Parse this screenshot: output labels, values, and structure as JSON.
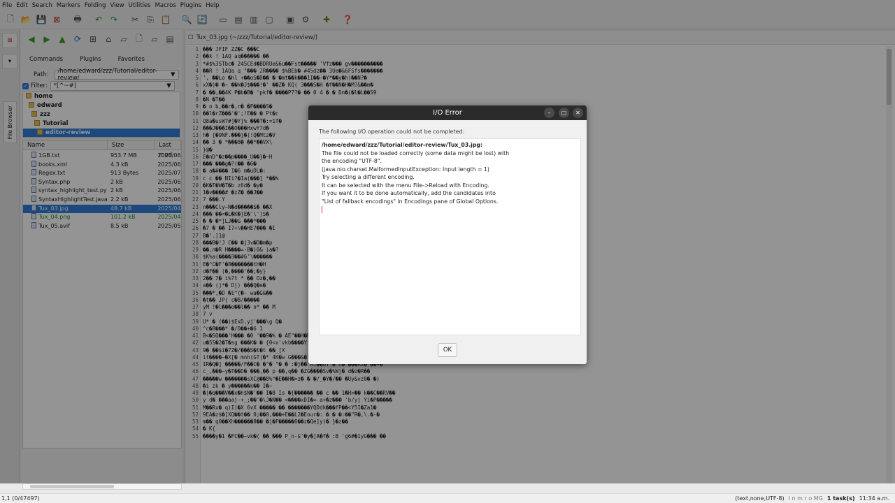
{
  "menu": [
    "File",
    "Edit",
    "Search",
    "Markers",
    "Folding",
    "View",
    "Utilities",
    "Macros",
    "Plugins",
    "Help"
  ],
  "fb": {
    "tabs": [
      "Commands",
      "Plugins",
      "Favorites"
    ],
    "path_label": "Path:",
    "path_value": "/home/edward/zzz/Tutorial/editor-review/",
    "filter_label": "Filter:",
    "filter_value": "*[^~#]",
    "tree": [
      "home",
      "edward",
      "zzz",
      "Tutorial",
      "editor-review"
    ],
    "cols": [
      "Name",
      "Size",
      "Last mod"
    ],
    "files": [
      [
        "1GB.txt",
        "953.7 MB",
        "2025/06/"
      ],
      [
        "books.xml",
        "4.3 kB",
        "2025/06/"
      ],
      [
        "Regex.txt",
        "913 Bytes",
        "2025/07/"
      ],
      [
        "Syntax.php",
        "2 kB",
        "2025/06/"
      ],
      [
        "syntax_highlight_test.py",
        "2 kB",
        "2025/06/"
      ],
      [
        "SyntaxHighlightTest.java",
        "2.2 kB",
        "2025/06/"
      ],
      [
        "Tux_03.jpg",
        "48.7 kB",
        "2025/04/"
      ],
      [
        "Tux_04.png",
        "101.2 kB",
        "2025/04/"
      ],
      [
        "Tux_05.avif",
        "8.5 kB",
        "2025/05/"
      ]
    ],
    "vtab": "File Browser"
  },
  "editor": {
    "title": "Tux_03.jpg (~/zzz/Tutorial/editor-review/)",
    "lines": [
      "\u0000\u0000\u0000 JFIF ZZ\u0000C \u0000\u0000\u0000C",
      "\u0000\u0000k ! 1AQ aq\u0000\u0000\u0000\u0000\u0000\u0000 \u0000\u0000",
      "*#$%3STbc\u0000 245CEd\u0000BDRUe&6u\u0000\u0000Fst\u0000\u0000\u0000\u0000\u0000 'Vfz\u0000\u0000\u0000 gv\u0000\u0000\u0000\u0000\u0000\u0000\u0000\u0000\u0000\u0000",
      "\u0000\u0000R ! 1AQa q \"\u0000\u0000\u0000 2R\u0000\u0000\u0000\u0000 $%BEb\u0000 #45dz\u0000\u0000 3Ue\u0000&6FSfs\u0000\u0000\u0000\u0000\u0000\u0000\u0000",
      "', \u0000\u0000Lo \u0000hl +\u0000\u0000oS\u0000D\u0000\u0000 \u0000 \u0000mt\u0000\u0000k\u0000\u0000\u00001I\u0000\u0000-\u0000Y*\u0000\u0000y\u0000h)\u0000\u0000N?\u0000",
      "xX\u0000)\u0000 \u0000~ \u0000\u0000k\u0000J$\u0000\u0000\u0000!\u0000' \u0000\u0000Z\u0000 KQ( 3\u0000\u0000\u0000S\u0000H \u0000f\u0000\u0000N\u0000H\u0000M?&\u0000\u0000m\u0000",
      "\u0000 \u0000\u0000,\u0000\u00004K P\u0000b\u0000B\u0000 'pkf\u0000 \u0000\u0000\u0000\u0000P7?\u0000 \u0000\u0000 0 4 \u0000 \u0000 Dn\u0000(\u0000l\u0000L\u0000\u0000S9",
      "\u0000N \u0000T\u0000\u0000",
      "\u0000 o b,\u0000\u0000r\u0000,r\u0000 \u0000F\u0000\u0000\u0000\u0000S\u0000",
      "\u0000\u0000l\u0000rZ\u0000\u0000\u0000'\u0000';!E\u0000\u0000 \u0000 Pt\u0000c",
      "Q8a\u0000usW7#]\u0000Yj% \u0000\u0000\u0000T\u0000:=1f\u0000",
      "\u0000\u0000\u0000J\u0000\u0000\u0000I\u0000\u0000O\u0000\u0000\u0000HxwY7d\u0000",
      "h\u0000 [\u00009NF.\u0000\u0000\u0000j\u0000(!Q\u0000Mtz\u0000V",
      "\u0000\u0000 3 \u0000 *\u0000\u0000\u00008\u0000 \u0000\u0000*\u0000\u0000VX\\",
      "}@\u0000",
      "E\u0000nD^\u0000z\u0000\u0000p\u0000\u0000\u0000\u0000_U\u0000\u0000}\u0000~H",
      "\u0000\u0000\u0000 \u0000\u0000\u0000g\u0000?(\u0000\u0000 \u00006\u0000",
      "\u0000 a\u0000#\u0000\u0000\u0000 I\u00006 m\u0000uDL\u0000:",
      "c c \u0000\u0000 NIi?\u0000Ia(\u0000\u0000\u0000] *\u0000\u0000%",
      "\u0000K\u0000T\u0000W\u0000T\u0000b z6d\u0000 \u0000y\u0000",
      "1\u0000v\u0000\u0000\u0000\u0000# \u0000zZ\u0000 \u0000\u0000J\u0000\u0000",
      "7 \u0000\u0000\u0000.Y",
      "n\u0000\u0000\u0000Cly~N\u0000d\u0000\u0000\u0000\u0000\u0000S\u0000 \u0000\u0000X",
      "\u0000\u0000\u0000 \u0000\u0000<\u0000L\u0000K\u0000]E\u0000'\\']S\u0000",
      "\u0000 \u0000 \u0000*]LJ\u0000\u0000G \u0000\u0000\u0000*\u0000\u0000\u0000",
      "\u00007 \u0000 \u0000\u0000 I7+\\\u0000\u0000HE7\u0000\u0000\u0000 \u0000I",
      "B\u0000'.]1@",
      "\u0000\u0000\u0000B\u0000!J C\u0000\u0000 \u0000j3v\u0000D\u0000m\u0000p",
      "\u0000\u0000,n\u0000R H\u0000\u0000\u0000\u0000=-B\u0000)0& )a\u0000?",
      "$K%a(\u0000\u0000\u0000\u00003\u0000\u0000#6'\\\u0000\u0000\u0000\u0000\u0000\u0000",
      "E\u0000^C\u0000F'\u00008\u0000\u0000\u0000\u0000\u0000\u0000\u0000tH\u0000H",
      "d\u0000F\u0000\u0000 (\u0000,\u0000\u0000\u0000\u0000'\u0000\u0000;\u0000y}",
      "2\u0000\u0000 7\u0000 i%?t * \u0000\u0000 Oz\u0000,\u0000\u0000",
      "a\u0000\u0000 (j*\u0000 Dj) \u0000\u0000\u0000Q\u0000e\u0000",
      "\u0000\u0000\u0000*,\u0000D \u0000i^(\u0000- wa\u0000G&\u0000\u0000",
      "\u0000t\u0000\u0000 JP{ c\u0000B/\u0000\u0000\u0000\u0000\u0000",
      "yM !\u0000l\u0000\u0000\u0000o\u0000\u0000l\u0000\u0000 n* \u0000\u0000 M",
      "7 v",
      "U* \u0000 (\u0000\u0000)$ExD,yj'\u0000\u0000\u0000\\g Q\u0000",
      "^c\u00008\u0000\u0000\u0000* \u0000/D\u0000\u0000+\u00006 1",
      "B<\u0000SQ\u0000\u0000\u0000'H\u0000\u0000\u0000 \u00000 '\u0000\u00009\u0000% \u0000 AE\"\u0000\u0000H\u0000B% \u0000t \u00004\u0000\u0000\u0000Mr<3\u0000yn\u0000eY\u0000\u0000\u0000\u0000U\u0000 & mB?(\u0000\u0000x\u0000 \u0000F\u0000\u0000\u00007]& \u0000D\u0000",
      "u\u00005S\u00002\u0000T\u0000sg \u0000\u0000\u0000K\u0000 \u0000 {0<v'vkb\u0000\u0000\u0000\u0000Y u WtQ 6*V[\u0000<",
      "9\u0000 \u0000\u0000$i\u00007Z\u0000/\u0000\u0000\u0000S\u0000t\u0000t \u0000\u0000_[X",
      "it\u0000\u0000\u0000\u0000~\u0000X[\u0000 mnh(GT|\u0000* 4K\u0000w G\u0000\u0000\u0000&\u0000!hD\u0000\u0000R\u0000\u0000t\u0000 U\u0000F\u0000K\u0000\u0000\u0000\u0000 \u0000K\u0000",
      "IR\u0000Q\u0000] \u0000\u0000\u0000\u0000\u0000/F\u0000\u0000C\u0000 \u0000^\u0000 \"\u0000 \u0000 :\u0000j\u0000\u0000\"M:\u0000\u0000OY \u0000 H\u0000 \u0000\u0000\u0000Rx\u0000 \u0000\u0000+\u0000",
      "c_,\u0000\u0000\u0000~y\u0000T\u0000\u0000D\u0000 \u0000\u0000\u0000,\u0000\u0000 p \u0000\u0000,q\u0000\u0000 \u0000ZG\u0000\u0000\u0000\u0000Sv\u0000%Wj\u0000 d\u0000z\u0000R\u0000\u0000",
      "\u0000\u0000\u0000\u0000\u0000w \u0000\u0000\u0000\u0000\u0000\u0000\u0000sXC@\u0000\u00008%^\u0000E\u0000\u0000H\u0000>z\u0000 \u0000 \u0000/_\u0000Y\u0000/\u0000\u0000 \u0000Uy&vz0\u0000 \u0000)",
      "\u0000i zk \u0000 y\u0000\u0000\u0000\u0000\u0000\u0000k\u0000\u0000 I\u0000~",
      "\u0000)\u0000q\u0000\u0000\u0000V\u0000\u0000x\u0000h$N\u0000'\u0000\u0000 I\u00008 Is \u0000{\u0000\u0000\u0000\u0000\u0000\u0000 \u0000\u0000 c \u0000\u0000 1\u0000H>\u0000\u0000 k\u0000\u0000C\u0000\u0000RV\u0000\u0000",
      "y d\u0000 \u0000\u0000\u0000aaj-+_;\u0000\u0000'\u0000\\J\u0000N\u0000\u0000 <\u0000\u0000\u0000\u0000xDI\u0000= a+\u0000z\u0000\u0000\u0000 'b/yj Yi\u0000P\u0000\u0000\u0000\u0000\u0000",
      "M\u0000\u0000Rx\u0000 q)I)\u0000X 6vX \u0000\u0000\u0000\u0000\u0000 \u0000\u0000 \u0000\u0000\u0000\u0000\u0000\u0000\u0000YQDdk\u0000\u0000\u0000fP\u0000\u0000<Y5I\u0000Za1\u0000",
      "9EA\u0000z$\u0000[XQ\u0000\u0000t\u0000\u0000 0;\u0000\u00000,\u0000\u0000\u0000+E\u0000\u0000L2\u0000Eour\u0000: \u0000 \u0000 \u0000:\u0000\u0000\"R\u0000,\\.\u0000-\u0000",
      "m\u0000\u0000 q0\u0000\u0000Xh\u0000\u0000\u0000\u0000\u0000\u00008\u0000\u0000 \u0000|\u0000F\u0000\u0000\u0000\u0000\u00006\u0000\u0000z\u0000Qe]y)\u0000 }\u0000z\u0000\u0000",
      "\u0000 K{",
      "\u0000\u0000\u0000\u0000y\u00001 \u0000FC\u0000\u0000~vk\u0000( \u0000\u0000 \u0000\u0000\u0000 P_n-$'\u0000y\u0000]A\u0000f\u0000 :B 'g6#\u00001yG\u0000\u0000\u0000 \u0000\u0000"
    ]
  },
  "dialog": {
    "title": "I/O Error",
    "intro": "The following I/O operation could not be completed:",
    "lines": [
      "/home/edward/zzz/Tutorial/editor-review/Tux_03.jpg:",
      "The file could not be loaded correctly (some data might be lost) with",
      "the encoding \"UTF-8\".",
      "(java.nio.charset.MalformedInputException: Input length = 1)",
      "Try selecting a different encoding.",
      "It can be selected with the menu File->Reload with Encoding.",
      "If you want it to be done automatically, add the candidates into",
      "\"List of fallback encodings\" in Encodings pane of Global Options."
    ],
    "ok": "OK",
    "min": "–",
    "max": "▢",
    "close": "✕"
  },
  "status": {
    "left": "1,1 (0/47497)",
    "mode": "(text,none,UTF-8)",
    "flags": "I n m r o MG",
    "tasks": "1 task(s)",
    "time": "11:34 a.m."
  }
}
